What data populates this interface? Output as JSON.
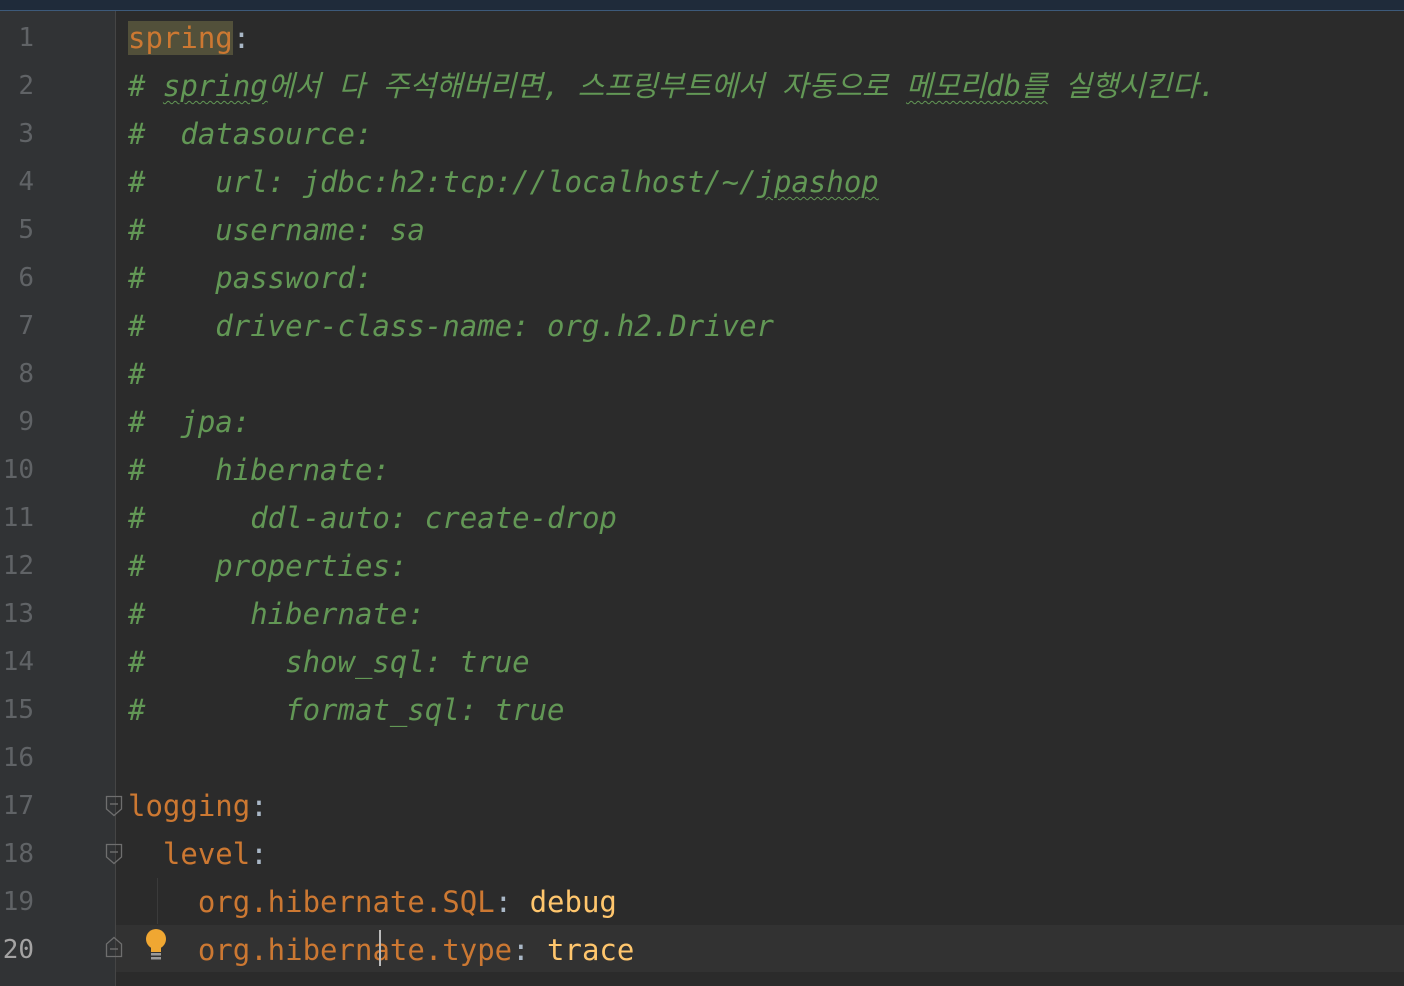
{
  "editor": {
    "language": "yaml",
    "current_line": 20,
    "colors": {
      "background": "#2b2b2b",
      "gutter": "#313335",
      "comment": "#629755",
      "key": "#cc7832",
      "scalar": "#ffc66d",
      "line_number": "#606366"
    },
    "line_numbers": [
      "1",
      "2",
      "3",
      "4",
      "5",
      "6",
      "7",
      "8",
      "9",
      "10",
      "11",
      "12",
      "13",
      "14",
      "15",
      "16",
      "17",
      "18",
      "19",
      "20"
    ],
    "lines": {
      "l1": {
        "key": "spring",
        "colon": ":"
      },
      "l2": {
        "hash": "# ",
        "word": "spring",
        "mid": "에서 다 주석해버리면, 스프링부트에서 자동으로 ",
        "word2": "메모리db를",
        "end": " 실행시킨다."
      },
      "l3": "#  datasource:",
      "l4": {
        "text": "#    url: jdbc:h2:tcp://localhost/~/",
        "word": "jpashop"
      },
      "l5": "#    username: sa",
      "l6": "#    password:",
      "l7": "#    driver-class-name: org.h2.Driver",
      "l8": "#",
      "l9": "#  jpa:",
      "l10": "#    hibernate:",
      "l11": "#      ddl-auto: create-drop",
      "l12": "#    properties:",
      "l13": "#      hibernate:",
      "l14": "#        show_sql: true",
      "l15": "#        format_sql: true",
      "l16": "",
      "l17": {
        "key": "logging",
        "colon": ":"
      },
      "l18": {
        "indent": "  ",
        "key": "level",
        "colon": ":"
      },
      "l19": {
        "indent": "    ",
        "key": "org.hibernate.SQL",
        "colon": ": ",
        "value": "debug"
      },
      "l20": {
        "indent": "    ",
        "key": "org.hibernate.type",
        "colon": ": ",
        "value": "trace"
      }
    },
    "icons": {
      "fold": "fold-marker-icon",
      "intention": "lightbulb-icon"
    }
  }
}
